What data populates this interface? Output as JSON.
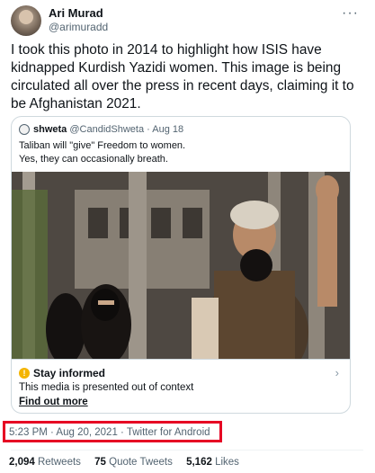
{
  "author": {
    "display_name": "Ari Murad",
    "handle": "@arimuradd"
  },
  "more_icon": "more-horizontal-icon",
  "tweet_text": "I took this photo in 2014 to highlight how ISIS have kidnapped Kurdish Yazidi women. This image is being circulated all over the press in recent days, claiming it to be Afghanistan 2021.",
  "quote": {
    "name": "shweta",
    "meta": "@CandidShweta · Aug 18",
    "line1": "Taliban will \"give\" Freedom to women.",
    "line2": "Yes, they can occasionally breath."
  },
  "notice": {
    "icon": "alert-icon",
    "title": "Stay informed",
    "description": "This media is presented out of context",
    "link": "Find out more"
  },
  "timestamp": "5:23 PM · Aug 20, 2021 · Twitter for Android",
  "stats": {
    "retweets_count": "2,094",
    "retweets_label": "Retweets",
    "quotes_count": "75",
    "quotes_label": "Quote Tweets",
    "likes_count": "5,162",
    "likes_label": "Likes"
  },
  "colors": {
    "highlight": "#e60023",
    "alert": "#f4b400"
  }
}
